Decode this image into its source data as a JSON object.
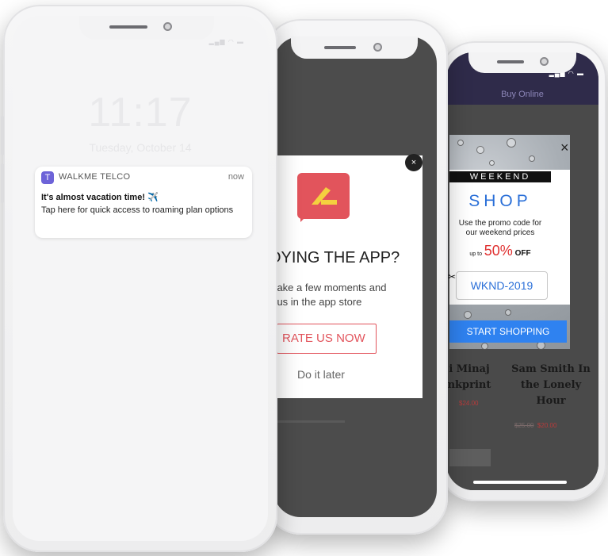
{
  "lock_screen": {
    "time": "11:17",
    "date": "Tuesday, October 14",
    "notification": {
      "app_icon_letter": "T",
      "app_name": "WALKME TELCO",
      "time": "now",
      "title": "It's almost vacation time! ✈️",
      "body": "Tap here for quick access to roaming plan options"
    }
  },
  "rate_popup": {
    "close_label": "×",
    "title": "JOYING THE APP?",
    "subtitle_line1": "e take a few moments and",
    "subtitle_line2": "te us in the app store",
    "rate_button": "RATE US NOW",
    "later_link": "Do it later"
  },
  "shop_screen": {
    "header_title": "Buy Online",
    "promo": {
      "banner": "WEEKEND",
      "headline": "SHOP",
      "text_line1": "Use the promo code for",
      "text_line2": "our weekend prices",
      "upto": "up to",
      "percent": "50%",
      "off": "OFF",
      "code": "WKND-2019",
      "cta": "START SHOPPING",
      "close_label": "×",
      "scissors": "✂"
    },
    "products": [
      {
        "title_line1": "i Minaj",
        "title_line2": "nkprint",
        "price": "$24.00"
      },
      {
        "title_line1": "Sam Smith In",
        "title_line2": "the Lonely",
        "title_line3": "Hour",
        "old_price": "$25.00",
        "price": "$20.00"
      }
    ]
  },
  "colors": {
    "accent_red": "#e2545c",
    "shop_blue": "#2a6fd8",
    "notif_icon": "#6d63d8"
  }
}
